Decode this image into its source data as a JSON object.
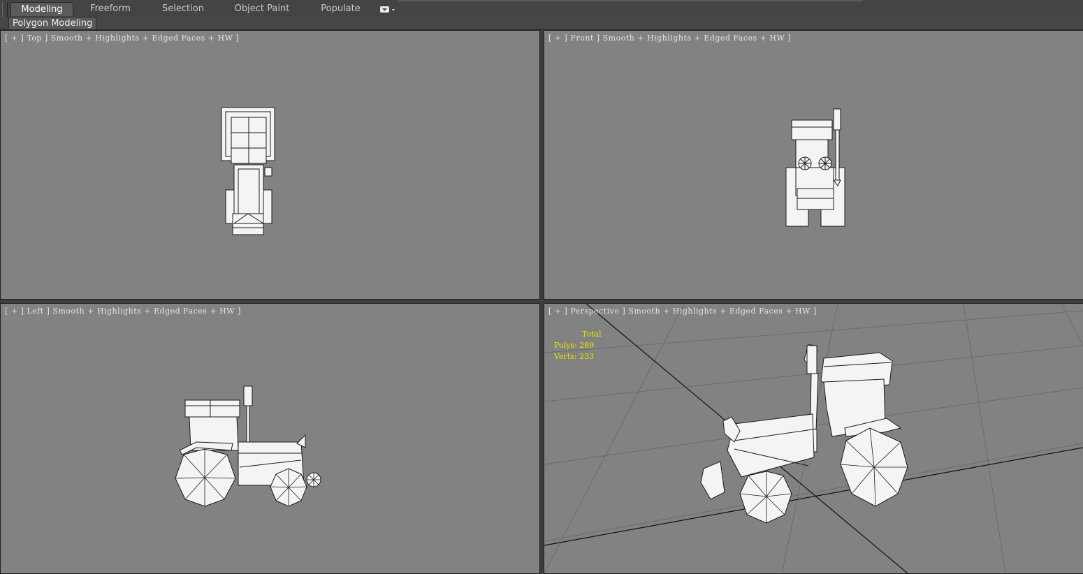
{
  "ribbon": {
    "tabs": [
      "Modeling",
      "Freeform",
      "Selection",
      "Object Paint",
      "Populate"
    ],
    "active_tab": "Modeling",
    "panel_label": "Polygon Modeling"
  },
  "viewports": {
    "top": {
      "plus": "+",
      "name": "Top",
      "mode": "Smooth + Highlights + Edged Faces + HW"
    },
    "front": {
      "plus": "+",
      "name": "Front",
      "mode": "Smooth + Highlights + Edged Faces + HW"
    },
    "left": {
      "plus": "+",
      "name": "Left",
      "mode": "Smooth + Highlights + Edged Faces + HW"
    },
    "perspective": {
      "plus": "+",
      "name": "Perspective",
      "mode": "Smooth + Highlights + Edged Faces + HW"
    }
  },
  "stats": {
    "total_label": "Total",
    "polys_label": "Polys:",
    "polys_value": "289",
    "verts_label": "Verts:",
    "verts_value": "233"
  },
  "colors": {
    "viewport_bg": "#828282",
    "stats_text": "#e6e600",
    "model_fill": "#f4f4f4",
    "model_edge": "#1a1a1a"
  }
}
